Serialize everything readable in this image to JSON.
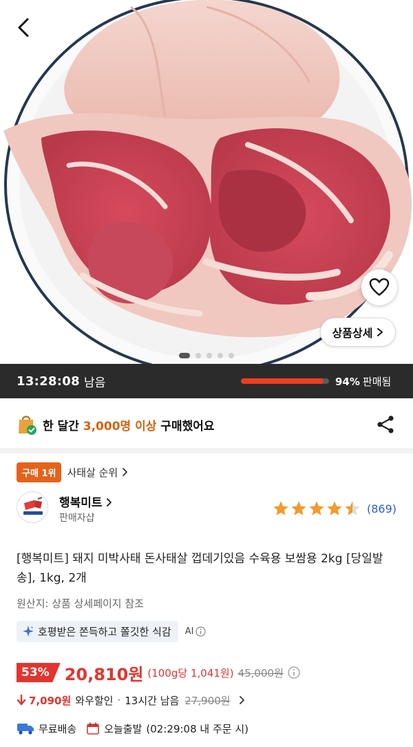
{
  "header": {
    "back_icon": "chevron-left-icon"
  },
  "gallery": {
    "slide_count": 5,
    "active_slide": 1,
    "detail_button_label": "상품상세"
  },
  "timer": {
    "time": "13:28:08",
    "suffix": "남음",
    "sold_percent": 94,
    "sold_percent_text": "94%",
    "sold_label": "판매됨"
  },
  "buyers": {
    "prefix": "한 달간 ",
    "highlight": "3,000명 이상",
    "suffix": " 구매했어요"
  },
  "rank": {
    "badge": "구매 1위",
    "category": "사태살 순위"
  },
  "seller": {
    "name": "행복미트",
    "type": "판매자샵",
    "rating": 4.5,
    "review_count": "(869)"
  },
  "product": {
    "title": "[행복미트] 돼지 미박사태 돈사태살 껍데기있음 수육용 보쌈용 2kg [당일발송], 1kg, 2개",
    "origin": "원산지: 상품 상세페이지 참조",
    "ai_summary": "호평받은 쫀득하고 쫄깃한 식감",
    "ai_label": "AI"
  },
  "price": {
    "discount": "53%",
    "amount": "20,810원",
    "unit_price": "(100g당 1,041원)",
    "original": "45,000원"
  },
  "wow": {
    "amount": "7,090원",
    "label": "와우할인",
    "separator": "·",
    "remaining": "13시간 남음",
    "original": "27,900원"
  },
  "shipping": {
    "free": "무료배송",
    "dispatch": "오늘출발",
    "deadline": "(02:29:08 내 주문 시)"
  },
  "colors": {
    "accent_red": "#e3342f",
    "badge_orange": "#e5621b",
    "highlight_orange": "#d9610b",
    "timer_bg": "#2b2b2b",
    "link_blue": "#2a5bd7",
    "star": "#f39a2b"
  }
}
